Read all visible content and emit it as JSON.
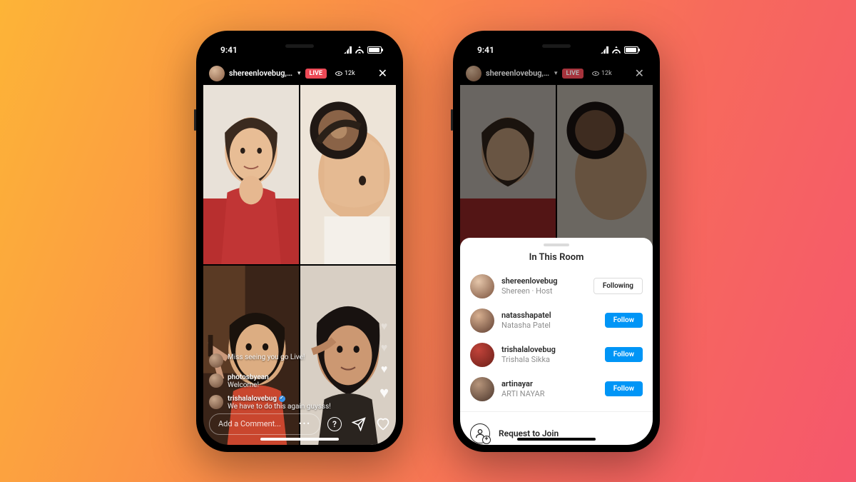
{
  "status": {
    "time": "9:41"
  },
  "live": {
    "host_label": "shereenlovebug, n...",
    "live_badge": "LIVE",
    "viewers": "12k",
    "close": "✕"
  },
  "comments": [
    {
      "user": "",
      "text": "Miss seeing you go Live!"
    },
    {
      "user": "photosbyean",
      "text": "Welcome!"
    },
    {
      "user": "trishalalovebug",
      "text": "We have to do this again guysss!",
      "verified": true
    }
  ],
  "comment_input": {
    "placeholder": "Add a Comment..."
  },
  "hearts": [
    "♥",
    "♥",
    "♥",
    "♥"
  ],
  "sheet": {
    "title": "In This Room",
    "items": [
      {
        "user": "shereenlovebug",
        "sub": "Shereen · Host",
        "btn": "Following",
        "style": "following"
      },
      {
        "user": "natasshapatel",
        "sub": "Natasha Patel",
        "btn": "Follow",
        "style": "follow"
      },
      {
        "user": "trishalalovebug",
        "sub": "Trishala Sikka",
        "btn": "Follow",
        "style": "follow"
      },
      {
        "user": "artinayar",
        "sub": "ARTI NAYAR",
        "btn": "Follow",
        "style": "follow"
      }
    ],
    "request": "Request to Join"
  }
}
